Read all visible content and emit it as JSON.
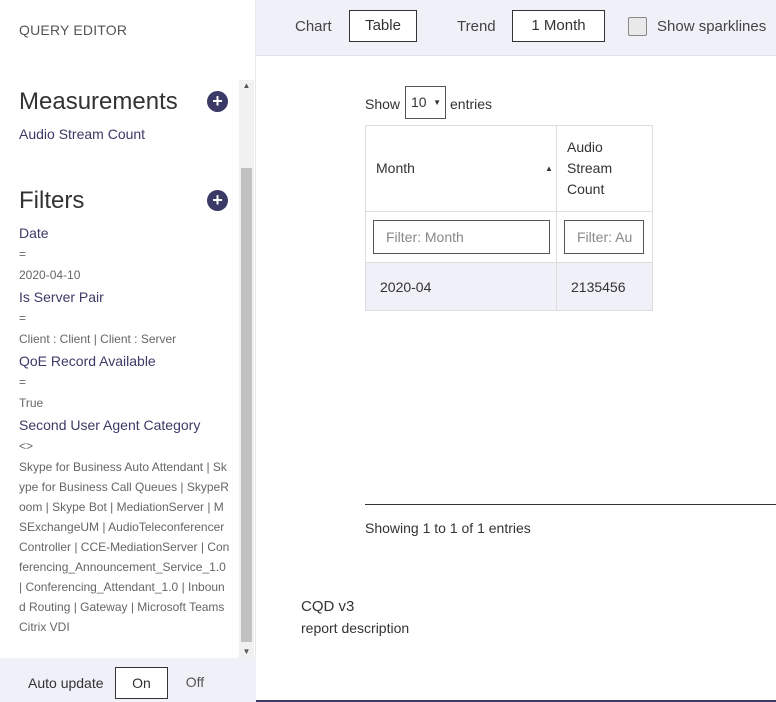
{
  "left_pane": {
    "title": "QUERY EDITOR",
    "measurements_title": "Measurements",
    "measurements": [
      "Audio Stream Count"
    ],
    "filters_title": "Filters",
    "filters": [
      {
        "name": "Date",
        "op": "=",
        "value": "2020-04-10"
      },
      {
        "name": "Is Server Pair",
        "op": "=",
        "value": "Client : Client | Client : Server"
      },
      {
        "name": "QoE Record Available",
        "op": "=",
        "value": "True"
      },
      {
        "name": "Second User Agent Category",
        "op": "<>",
        "value": "Skype for Business Auto Attendant | Skype for Business Call Queues | SkypeRoom | Skype Bot | MediationServer | MSExchangeUM | AudioTeleconferencerController | CCE-MediationServer | Conferencing_Announcement_Service_1.0 | Conferencing_Attendant_1.0 | Inbound Routing | Gateway | Microsoft Teams Citrix VDI"
      }
    ],
    "auto_update": {
      "label": "Auto update",
      "on": "On",
      "off": "Off"
    }
  },
  "toolbar": {
    "chart_label": "Chart",
    "table_button": "Table",
    "trend_label": "Trend",
    "trend_button": "1 Month",
    "sparklines_label": "Show sparklines"
  },
  "table_view": {
    "show_label": "Show",
    "page_size": "10",
    "entries_label": "entries",
    "columns": [
      "Month",
      "Audio Stream Count"
    ],
    "column_count_lines": [
      "Audio",
      "Stream",
      "Count"
    ],
    "filter_placeholders": [
      "Filter: Month",
      "Filter: Au"
    ],
    "rows": [
      [
        "2020-04",
        "2135456"
      ]
    ],
    "showing": "Showing 1 to 1 of 1 entries"
  },
  "report": {
    "name": "CQD v3",
    "description": "report description"
  },
  "colors": {
    "accent": "#3b3a66",
    "panel_bg": "#f0f0f8"
  }
}
